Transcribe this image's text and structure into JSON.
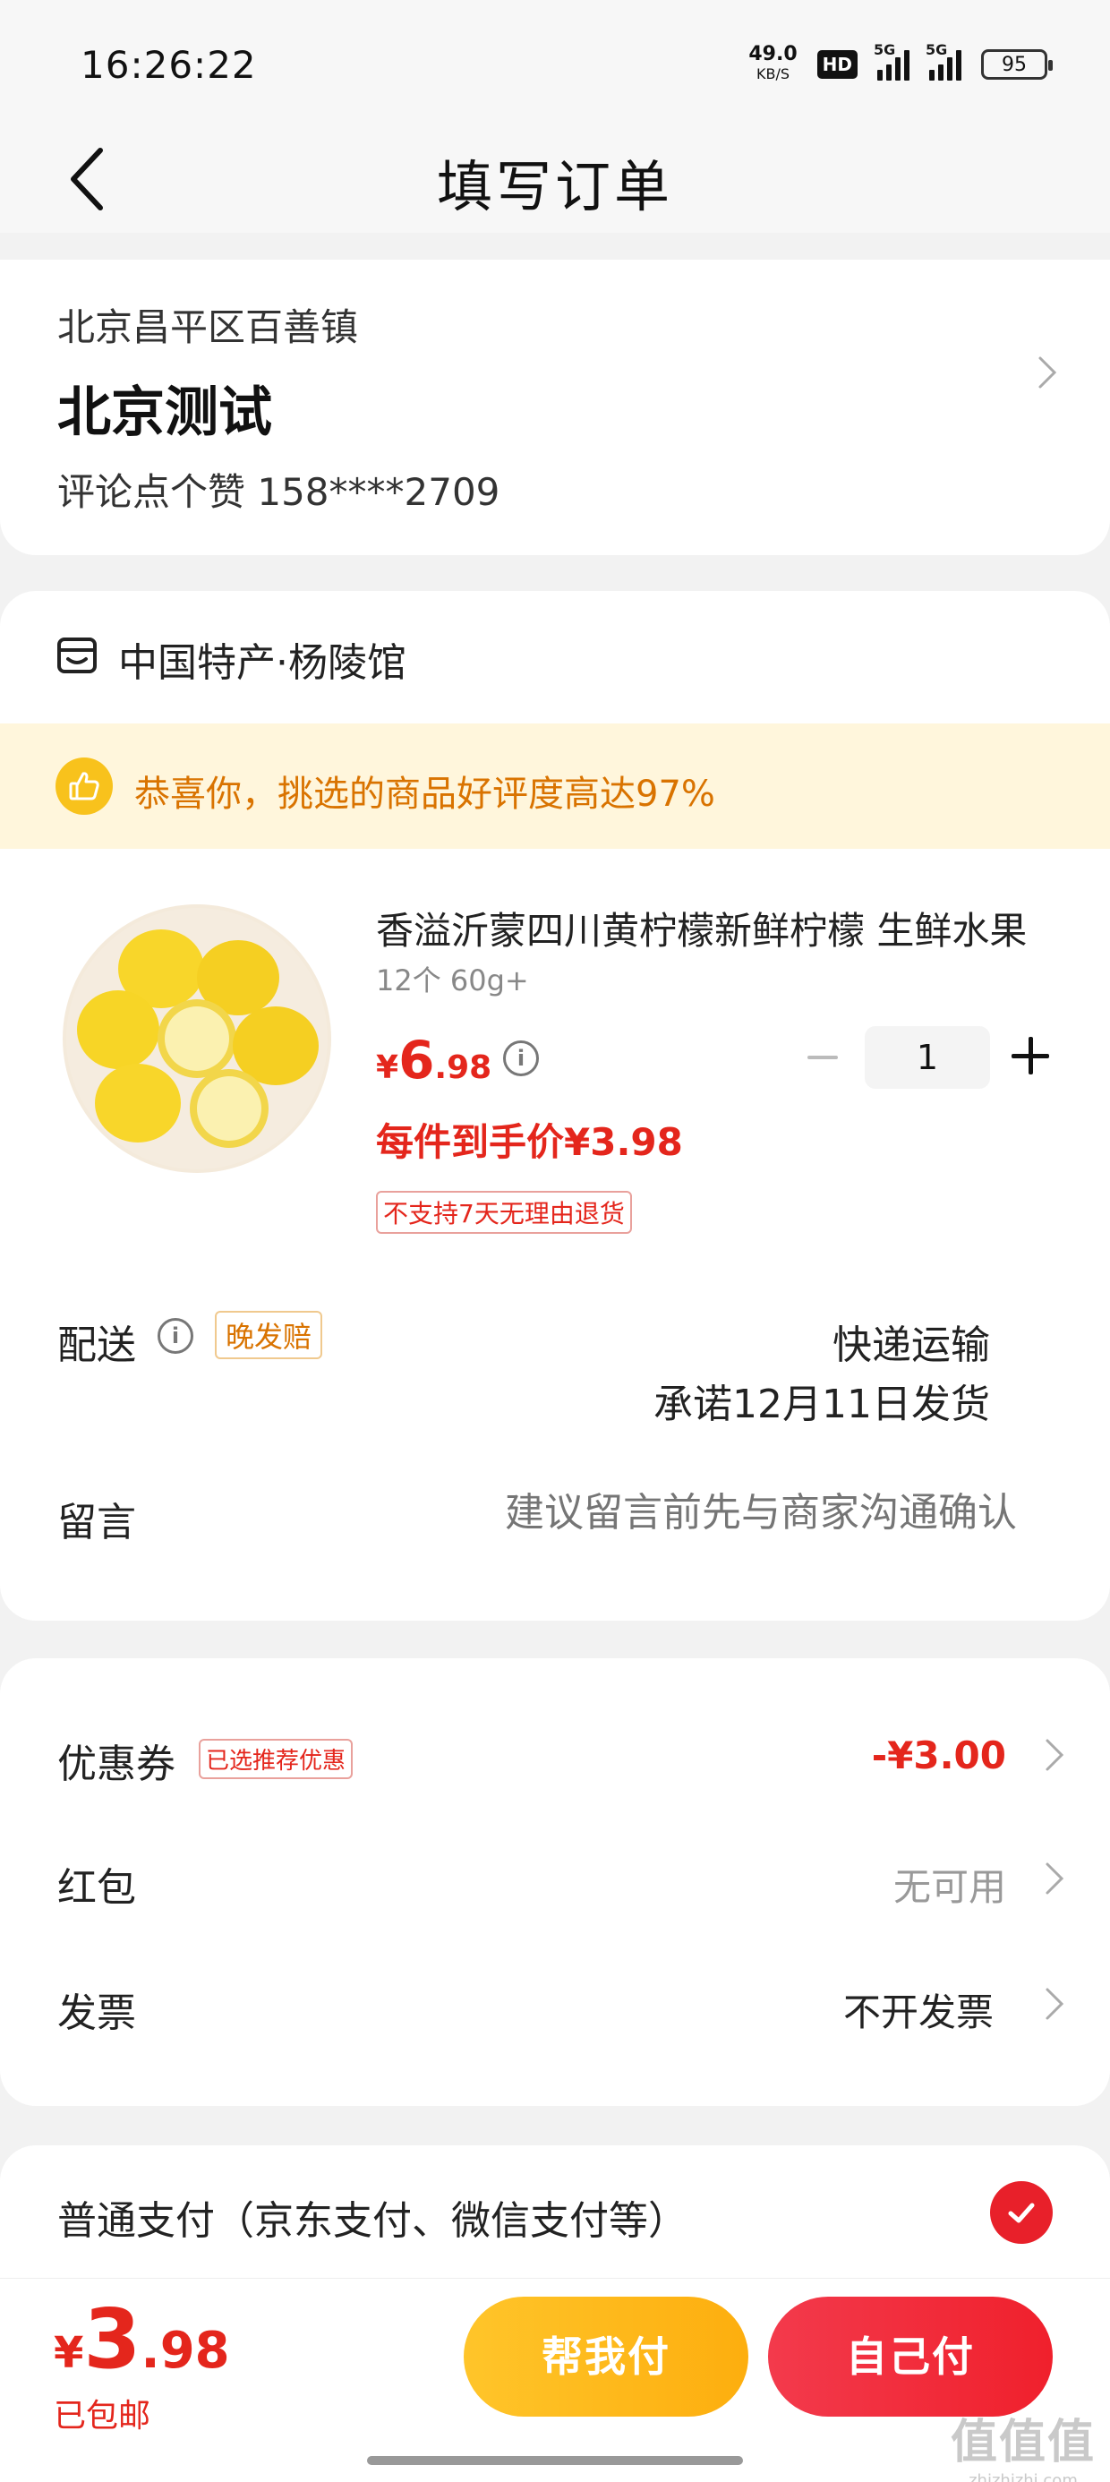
{
  "status_bar": {
    "time": "16:26:22",
    "net_speed_value": "49.0",
    "net_speed_unit": "KB/S",
    "hd_badge": "HD",
    "signal_tag_1": "5G",
    "signal_tag_2": "5G",
    "battery": "95"
  },
  "header": {
    "title": "填写订单",
    "back_icon": "chevron-left-icon"
  },
  "address": {
    "region": "北京昌平区百善镇",
    "name": "北京测试",
    "contact": "评论点个赞  158****2709"
  },
  "shop": {
    "name": "中国特产·杨陵馆",
    "praise_text": "恭喜你，挑选的商品好评度高达97%"
  },
  "product": {
    "title": "香溢沂蒙四川黄柠檬新鲜柠檬  生鲜水果",
    "spec": "12个 60g+",
    "price_currency": "¥",
    "price_int": "6",
    "price_dec": ".98",
    "quantity": "1",
    "unit_price": "每件到手价¥3.98",
    "return_policy": "不支持7天无理由退货"
  },
  "delivery": {
    "label": "配送",
    "late_tag": "晚发赔",
    "method": "快递运输",
    "promise": "承诺12月11日发货"
  },
  "note": {
    "label": "留言",
    "placeholder": "建议留言前先与商家沟通确认"
  },
  "discounts": {
    "coupon_label": "优惠券",
    "coupon_tag": "已选推荐优惠",
    "coupon_value": "-¥3.00",
    "red_packet_label": "红包",
    "red_packet_value": "无可用",
    "invoice_label": "发票",
    "invoice_value": "不开发票"
  },
  "payment": {
    "method_label": "普通支付（京东支付、微信支付等）",
    "selected": true
  },
  "footer": {
    "total_currency": "¥",
    "total_int": "3",
    "total_dec": ".98",
    "shipping_note": "已包邮",
    "help_pay_label": "帮我付",
    "self_pay_label": "自己付"
  },
  "watermark": {
    "logo": "值值值",
    "url": "zhizhizhi.com"
  },
  "colors": {
    "accent_red": "#e4261c",
    "praise_orange": "#d97300",
    "help_button": "#fdb71a",
    "self_button": "#f0202c"
  }
}
